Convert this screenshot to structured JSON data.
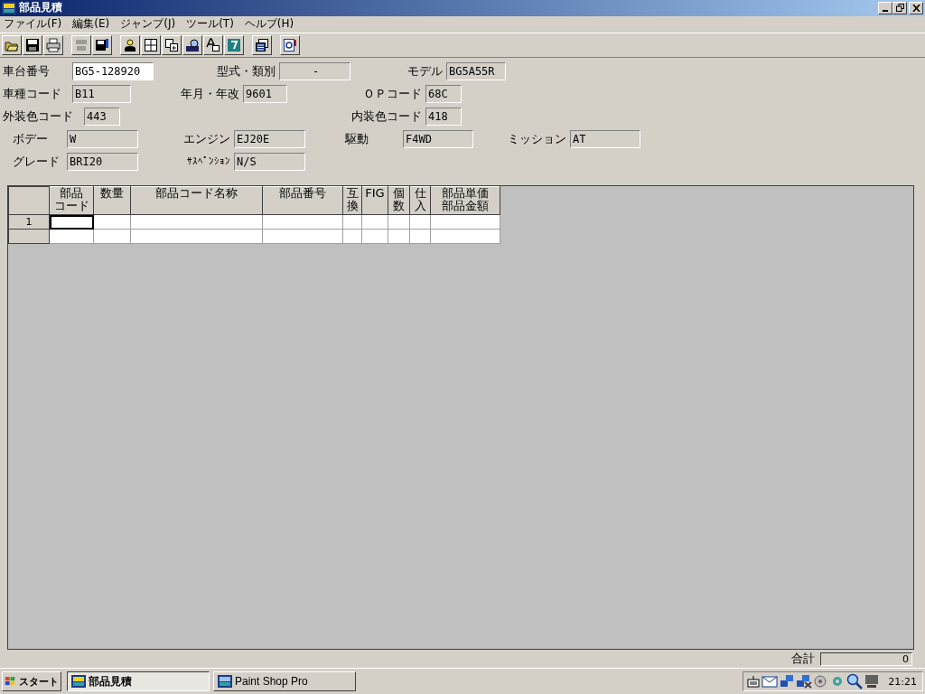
{
  "window": {
    "title": "部品見積"
  },
  "menu": [
    {
      "label": "ファイル(F)"
    },
    {
      "label": "編集(E)"
    },
    {
      "label": "ジャンプ(J)"
    },
    {
      "label": "ツール(T)"
    },
    {
      "label": "ヘルプ(H)"
    }
  ],
  "toolbar": [
    {
      "kind": "open",
      "disabled": false
    },
    {
      "kind": "save",
      "disabled": false
    },
    {
      "kind": "print",
      "disabled": false
    },
    {
      "kind": "number",
      "disabled": true
    },
    {
      "kind": "save-edit",
      "disabled": false
    },
    {
      "kind": "person",
      "disabled": false
    },
    {
      "kind": "grid",
      "disabled": false
    },
    {
      "kind": "swap",
      "disabled": false
    },
    {
      "kind": "find",
      "disabled": false
    },
    {
      "kind": "text",
      "disabled": false
    },
    {
      "kind": "help",
      "disabled": false
    },
    {
      "kind": "calc",
      "disabled": false
    },
    {
      "kind": "preview",
      "disabled": false
    }
  ],
  "form": [
    [
      {
        "label": "車台番号",
        "value": "BG5-128920",
        "editable": true
      },
      {
        "label": "型式・類別",
        "value": "-",
        "editable": false
      },
      {
        "label": "モデル",
        "value": "BG5A55R",
        "editable": false
      }
    ],
    [
      {
        "label": "車種コード",
        "value": "B11",
        "editable": false
      },
      {
        "label": "年月・年改",
        "value": "9601",
        "editable": false
      },
      {
        "label": "ＯＰコード",
        "value": "68C",
        "editable": false
      }
    ],
    [
      {
        "label": "外装色コード",
        "value": "443",
        "editable": false
      },
      {
        "label": "内装色コード",
        "value": "418",
        "editable": false
      }
    ],
    [
      {
        "label": "ボデー",
        "value": "W",
        "editable": false
      },
      {
        "label": "エンジン",
        "value": "EJ20E",
        "editable": false
      },
      {
        "label": "駆動",
        "value": "F4WD",
        "editable": false
      },
      {
        "label": "ミッション",
        "value": "AT",
        "editable": false
      }
    ],
    [
      {
        "label": "グレード",
        "value": "BRI20",
        "editable": false
      },
      {
        "label": "ｻｽﾍﾟﾝｼｮﾝ",
        "value": "N/S",
        "editable": false
      }
    ]
  ],
  "table": {
    "columns": [
      {
        "lines": [
          "部品",
          "コード"
        ]
      },
      {
        "lines": [
          "数量"
        ]
      },
      {
        "lines": [
          "部品コード名称"
        ]
      },
      {
        "lines": [
          "部品番号"
        ]
      },
      {
        "lines": [
          "互",
          "換"
        ]
      },
      {
        "lines": [
          "FIG"
        ]
      },
      {
        "lines": [
          "個",
          "数"
        ]
      },
      {
        "lines": [
          "仕",
          "入"
        ]
      },
      {
        "lines": [
          "部品単価",
          "部品金額"
        ]
      }
    ],
    "rows": [
      {
        "label": "1",
        "cursor": true
      },
      {
        "cursor": false
      }
    ]
  },
  "total": {
    "label": "合計",
    "value": "0"
  },
  "taskbar": {
    "start": "スタート",
    "tasks": [
      {
        "label": "部品見積",
        "selected": true
      },
      {
        "label": "Paint Shop Pro",
        "selected": false
      }
    ],
    "clock": "21:21"
  }
}
